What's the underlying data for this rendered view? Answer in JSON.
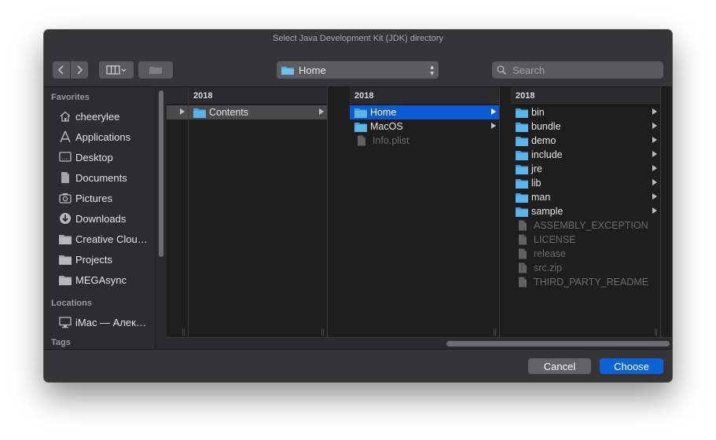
{
  "window": {
    "title": "Select Java Development Kit (JDK) directory"
  },
  "toolbar": {
    "location": "Home",
    "search_placeholder": "Search"
  },
  "sidebar": {
    "favorites_header": "Favorites",
    "favorites": [
      {
        "label": "cheerylee",
        "icon": "home-icon"
      },
      {
        "label": "Applications",
        "icon": "applications-icon"
      },
      {
        "label": "Desktop",
        "icon": "desktop-icon"
      },
      {
        "label": "Documents",
        "icon": "document-icon"
      },
      {
        "label": "Pictures",
        "icon": "camera-icon"
      },
      {
        "label": "Downloads",
        "icon": "download-icon"
      },
      {
        "label": "Creative Clou…",
        "icon": "folder-icon"
      },
      {
        "label": "Projects",
        "icon": "folder-icon"
      },
      {
        "label": "MEGAsync",
        "icon": "folder-icon"
      }
    ],
    "locations_header": "Locations",
    "locations": [
      {
        "label": "iMac — Алек…",
        "icon": "computer-icon"
      }
    ],
    "tags_header": "Tags"
  },
  "columns": [
    {
      "header": "2018",
      "items": [
        {
          "label": "Contents",
          "type": "folder",
          "has_children": true,
          "state": "path"
        }
      ]
    },
    {
      "header": "2018",
      "items": [
        {
          "label": "Home",
          "type": "folder",
          "has_children": true,
          "state": "selected"
        },
        {
          "label": "MacOS",
          "type": "folder",
          "has_children": true,
          "state": "normal"
        },
        {
          "label": "Info.plist",
          "type": "file",
          "has_children": false,
          "state": "disabled"
        }
      ]
    },
    {
      "header": "2018",
      "items": [
        {
          "label": "bin",
          "type": "folder",
          "has_children": true,
          "state": "normal"
        },
        {
          "label": "bundle",
          "type": "folder",
          "has_children": true,
          "state": "normal"
        },
        {
          "label": "demo",
          "type": "folder",
          "has_children": true,
          "state": "normal"
        },
        {
          "label": "include",
          "type": "folder",
          "has_children": true,
          "state": "normal"
        },
        {
          "label": "jre",
          "type": "folder",
          "has_children": true,
          "state": "normal"
        },
        {
          "label": "lib",
          "type": "folder",
          "has_children": true,
          "state": "normal"
        },
        {
          "label": "man",
          "type": "folder",
          "has_children": true,
          "state": "normal"
        },
        {
          "label": "sample",
          "type": "folder",
          "has_children": true,
          "state": "normal"
        },
        {
          "label": "ASSEMBLY_EXCEPTION",
          "type": "file",
          "has_children": false,
          "state": "disabled"
        },
        {
          "label": "LICENSE",
          "type": "file",
          "has_children": false,
          "state": "disabled"
        },
        {
          "label": "release",
          "type": "file",
          "has_children": false,
          "state": "disabled"
        },
        {
          "label": "src.zip",
          "type": "zip",
          "has_children": false,
          "state": "disabled"
        },
        {
          "label": "THIRD_PARTY_README",
          "type": "file",
          "has_children": false,
          "state": "disabled"
        }
      ]
    }
  ],
  "footer": {
    "cancel_label": "Cancel",
    "choose_label": "Choose"
  },
  "colors": {
    "accent": "#0a5bd3",
    "folder": "#5ab0e6",
    "window_bg": "#2b2b2d"
  }
}
